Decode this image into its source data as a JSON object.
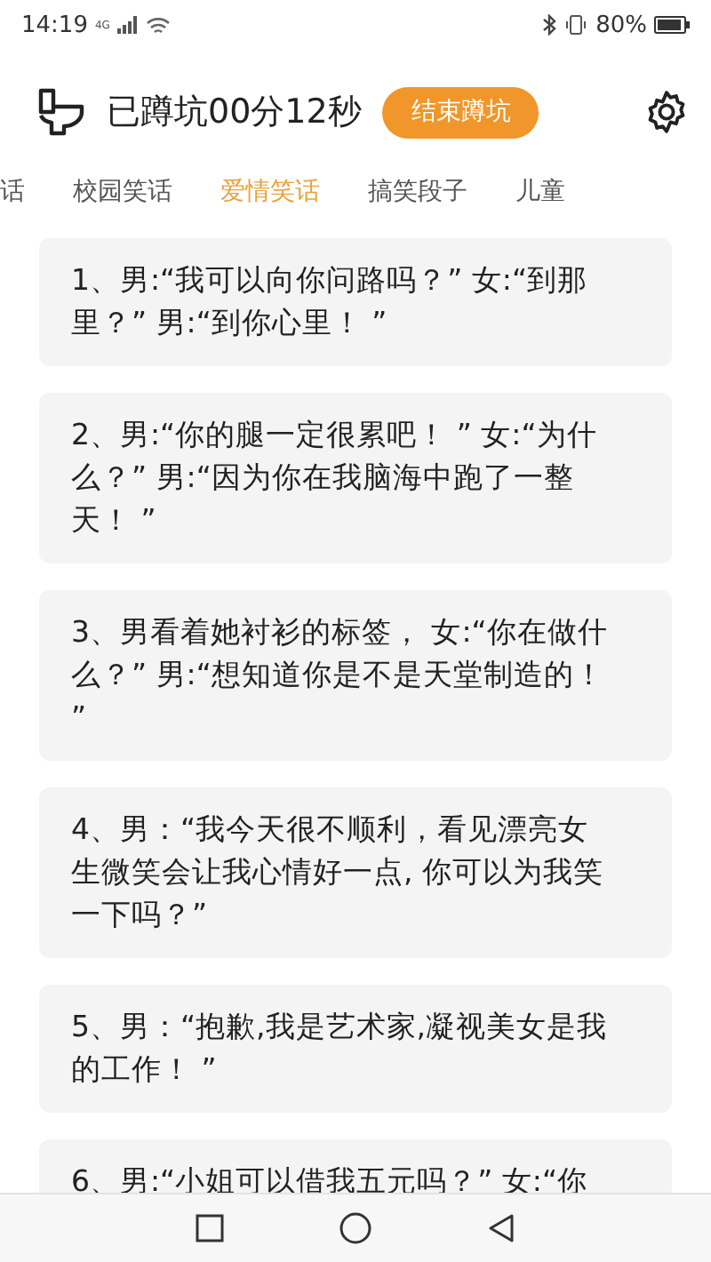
{
  "status_bar": {
    "time": "14:19",
    "network": "4G",
    "battery": "80%"
  },
  "header": {
    "timer": "已蹲坑00分12秒",
    "end_button": "结束蹲坑"
  },
  "tabs": [
    {
      "label": "话",
      "selected": false
    },
    {
      "label": "校园笑话",
      "selected": false
    },
    {
      "label": "爱情笑话",
      "selected": true
    },
    {
      "label": "搞笑段子",
      "selected": false
    },
    {
      "label": "儿童",
      "selected": false
    }
  ],
  "jokes": [
    "1、男:“我可以向你问路吗？” 女:“到那里？” 男:“到你心里！ ”",
    "2、男:“你的腿一定很累吧！ ” 女:“为什么？” 男:“因为你在我脑海中跑了一整天！ ”",
    "3、男看着她衬衫的标签， 女:“你在做什么？” 男:“想知道你是不是天堂制造的！ ”",
    "4、男：“我今天很不顺利，看见漂亮女生微笑会让我心情好一点, 你可以为我笑一下吗？”",
    "5、男：“抱歉,我是艺术家,凝视美女是我的工作！ ”",
    "6、男:“小姐可以借我五元吗？” 女:“你"
  ]
}
